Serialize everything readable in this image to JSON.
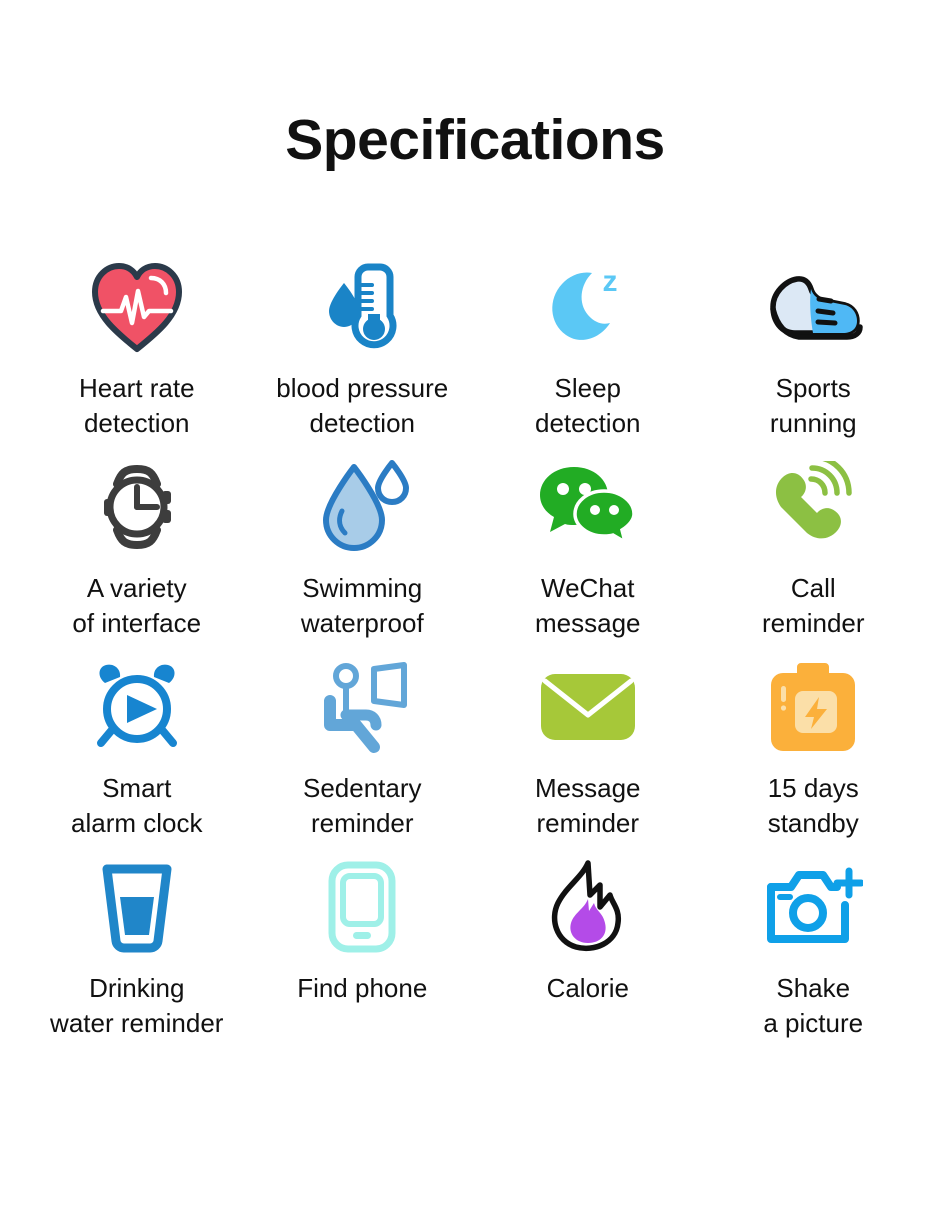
{
  "header": {
    "title": "Specifications"
  },
  "colors": {
    "heart_fill": "#F05266",
    "heart_stroke": "#2B3A4A",
    "thermometer_blue": "#1A84C7",
    "moon_blue": "#5BC8F5",
    "shoe_black": "#111111",
    "shoe_blue": "#4FB8F5",
    "shoe_pale": "#DCE8F5",
    "watch_gray": "#3D3D3D",
    "drop_stroke": "#2B7CC4",
    "drop_fill": "#A8CCE8",
    "wechat_green": "#22AC24",
    "call_green": "#8CC043",
    "alarm_blue": "#1785D0",
    "sedentary_blue": "#62A6D8",
    "envelope_green": "#A6C839",
    "battery_orange": "#FBB03B",
    "battery_inner": "#FBDFA8",
    "glass_blue": "#2086C9",
    "phone_cyan": "#9FF0E8",
    "flame_purple": "#B44BE8",
    "flame_black": "#111111",
    "camera_blue": "#0FA0E8",
    "text": "#111111",
    "background": "#FFFFFF"
  },
  "features": [
    {
      "icon": "heart-rate-icon",
      "label": "Heart rate\ndetection"
    },
    {
      "icon": "thermometer-drop-icon",
      "label": "blood pressure\ndetection"
    },
    {
      "icon": "crescent-moon-z-icon",
      "label": "Sleep\ndetection"
    },
    {
      "icon": "running-shoe-icon",
      "label": "Sports\nrunning"
    },
    {
      "icon": "wristwatch-icon",
      "label": "A variety\nof interface"
    },
    {
      "icon": "water-drops-icon",
      "label": "Swimming\nwaterproof"
    },
    {
      "icon": "wechat-bubbles-icon",
      "label": "WeChat\nmessage"
    },
    {
      "icon": "phone-handset-icon",
      "label": "Call\nreminder"
    },
    {
      "icon": "alarm-clock-play-icon",
      "label": "Smart\nalarm clock"
    },
    {
      "icon": "sedentary-desk-icon",
      "label": "Sedentary\nreminder"
    },
    {
      "icon": "envelope-icon",
      "label": "Message\nreminder"
    },
    {
      "icon": "battery-bolt-icon",
      "label": "15 days\nstandby"
    },
    {
      "icon": "water-glass-icon",
      "label": "Drinking\nwater reminder"
    },
    {
      "icon": "smartphone-icon",
      "label": "Find phone"
    },
    {
      "icon": "flame-icon",
      "label": "Calorie"
    },
    {
      "icon": "camera-plus-icon",
      "label": "Shake\na picture"
    }
  ]
}
